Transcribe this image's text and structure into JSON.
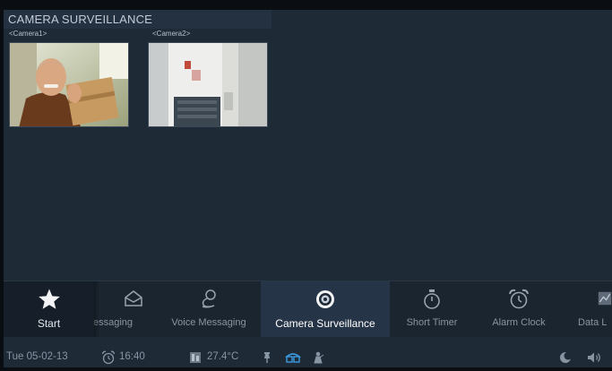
{
  "header": {
    "title": "CAMERA SURVEILLANCE"
  },
  "cameras": [
    {
      "label": "<Camera1>"
    },
    {
      "label": "<Camera2>"
    }
  ],
  "dock": {
    "start": {
      "label": "Start",
      "icon": "star-icon"
    },
    "items": [
      {
        "label": "essaging",
        "icon": "envelope-icon"
      },
      {
        "label": "Voice Messaging",
        "icon": "voice-message-icon"
      },
      {
        "label": "Camera Surveillance",
        "icon": "camera-lens-icon",
        "active": true
      },
      {
        "label": "Short Timer",
        "icon": "stopwatch-icon"
      },
      {
        "label": "Alarm Clock",
        "icon": "alarm-clock-icon"
      },
      {
        "label": "Data L",
        "icon": "chart-icon"
      }
    ]
  },
  "status": {
    "date": "Tue 05-02-13",
    "alarm_time": "16:40",
    "temperature": "27.4°C",
    "icons": [
      "alarm-clock-icon",
      "thermometer-icon",
      "pin-icon",
      "network-icon",
      "person-icon",
      "moon-icon",
      "speaker-icon"
    ]
  },
  "colors": {
    "background": "#1f2a37",
    "accent": "#3a9de0",
    "active_tab": "#253446"
  }
}
